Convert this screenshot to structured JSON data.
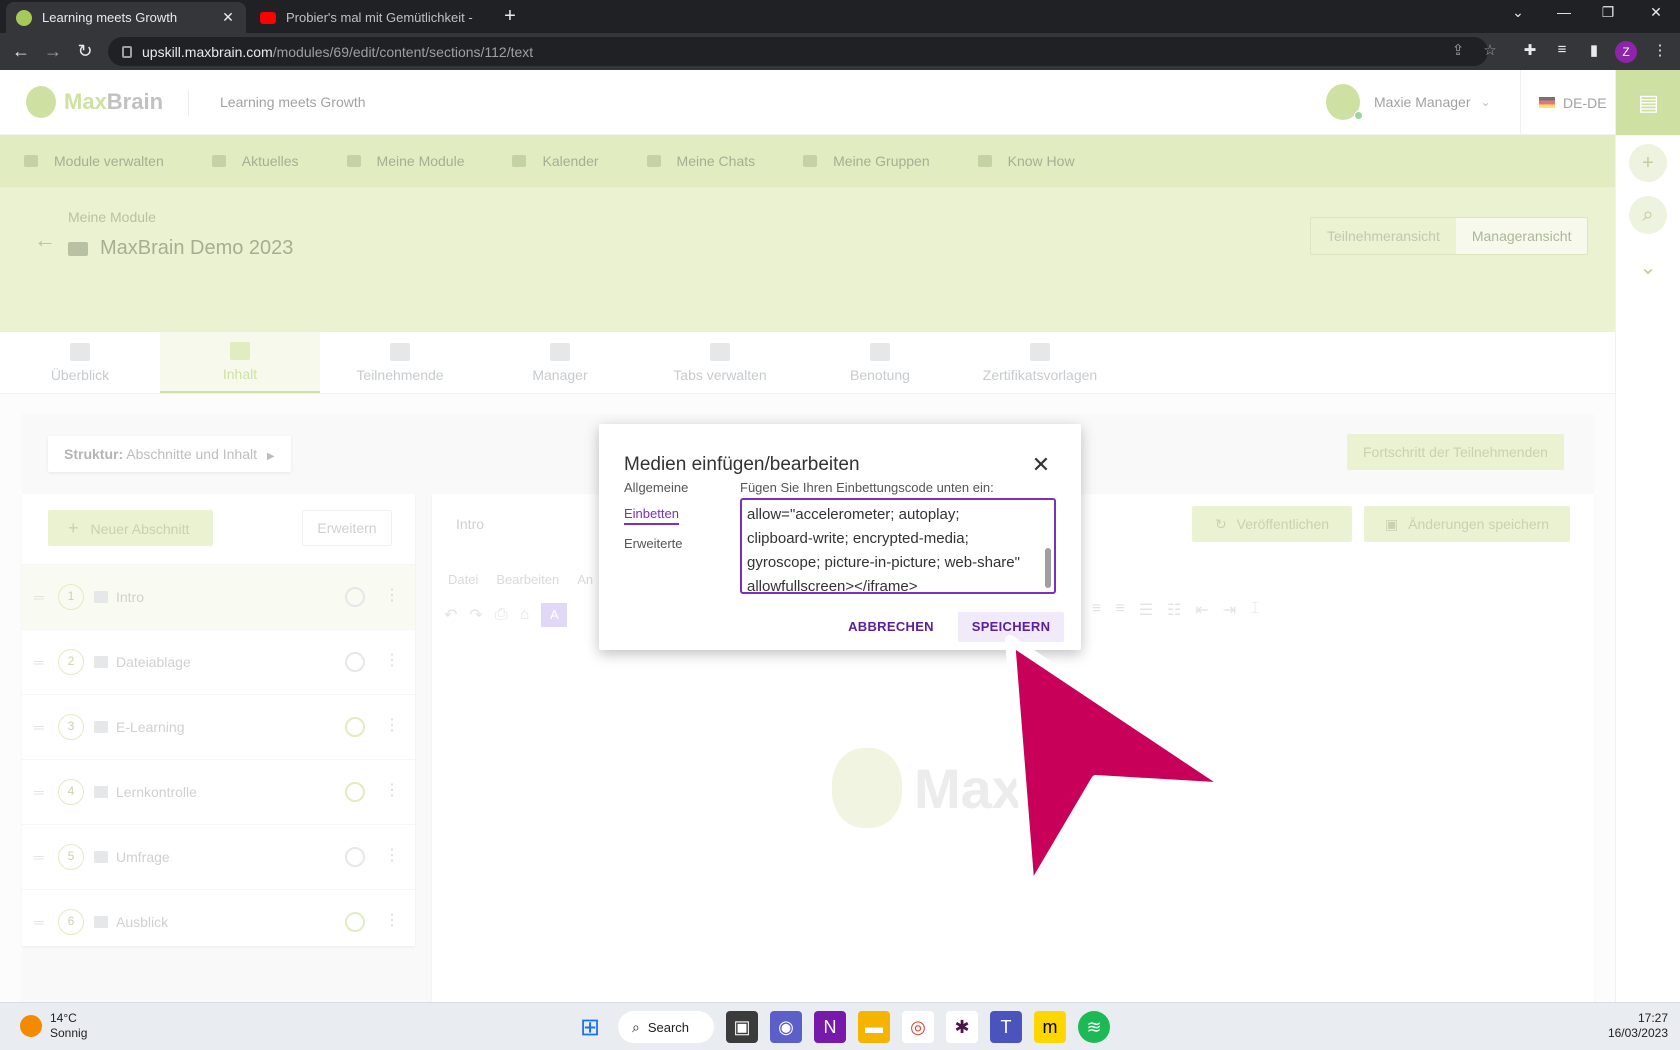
{
  "browser": {
    "tabs": [
      {
        "title": "Learning meets Growth",
        "active": true
      },
      {
        "title": "Probier's mal mit Gemütlichkeit -",
        "active": false
      }
    ],
    "url_host": "upskill.maxbrain.com",
    "url_path": "/modules/69/edit/content/sections/112/text",
    "profile_initial": "Z"
  },
  "header": {
    "logo_max": "Max",
    "logo_brain": "Brain",
    "tagline": "Learning meets Growth",
    "user_name": "Maxie Manager",
    "language": "DE-DE"
  },
  "main_nav": [
    {
      "label": "Module verwalten"
    },
    {
      "label": "Aktuelles"
    },
    {
      "label": "Meine Module"
    },
    {
      "label": "Kalender"
    },
    {
      "label": "Meine Chats"
    },
    {
      "label": "Meine Gruppen"
    },
    {
      "label": "Know How"
    }
  ],
  "course": {
    "breadcrumb": "Meine Module",
    "title": "MaxBrain Demo 2023",
    "view_participant": "Teilnehmeransicht",
    "view_manager": "Manageransicht"
  },
  "sub_tabs": [
    {
      "label": "Überblick",
      "active": false
    },
    {
      "label": "Inhalt",
      "active": true
    },
    {
      "label": "Teilnehmende",
      "active": false
    },
    {
      "label": "Manager",
      "active": false
    },
    {
      "label": "Tabs verwalten",
      "active": false
    },
    {
      "label": "Benotung",
      "active": false
    },
    {
      "label": "Zertifikatsvorlagen",
      "active": false
    }
  ],
  "content": {
    "structure_prefix": "Struktur:",
    "structure_label": "Abschnitte und Inhalt",
    "progress_button": "Fortschritt der Teilnehmenden",
    "new_section": "Neuer Abschnitt",
    "expand": "Erweitern",
    "sections": [
      {
        "num": "1",
        "label": "Intro",
        "status": "sync"
      },
      {
        "num": "2",
        "label": "Dateiablage",
        "status": "sync"
      },
      {
        "num": "3",
        "label": "E-Learning",
        "status": "done"
      },
      {
        "num": "4",
        "label": "Lernkontrolle",
        "status": "done"
      },
      {
        "num": "5",
        "label": "Umfrage",
        "status": "sync"
      },
      {
        "num": "6",
        "label": "Ausblick",
        "status": "done"
      }
    ]
  },
  "editor": {
    "title": "Intro",
    "publish": "Veröffentlichen",
    "save_changes": "Änderungen speichern",
    "menu": [
      "Datei",
      "Bearbeiten",
      "An"
    ]
  },
  "dialog": {
    "title": "Medien einfügen/bearbeiten",
    "tabs": [
      {
        "label": "Allgemeine",
        "active": false
      },
      {
        "label": "Einbetten",
        "active": true
      },
      {
        "label": "Erweiterte",
        "active": false
      }
    ],
    "embed_label": "Fügen Sie Ihren Einbettungscode unten ein:",
    "embed_code": "allow=\"accelerometer; autoplay;\nclipboard-write; encrypted-media;\ngyroscope; picture-in-picture; web-share\"\nallowfullscreen></iframe>",
    "cancel": "ABBRECHEN",
    "save": "SPEICHERN"
  },
  "taskbar": {
    "temperature": "14°C",
    "weather": "Sonnig",
    "search": "Search",
    "time": "17:27",
    "date": "16/03/2023"
  },
  "colors": {
    "brand_green": "#a7c957",
    "dialog_accent": "#7b2fbe",
    "cursor": "#c8005a"
  }
}
